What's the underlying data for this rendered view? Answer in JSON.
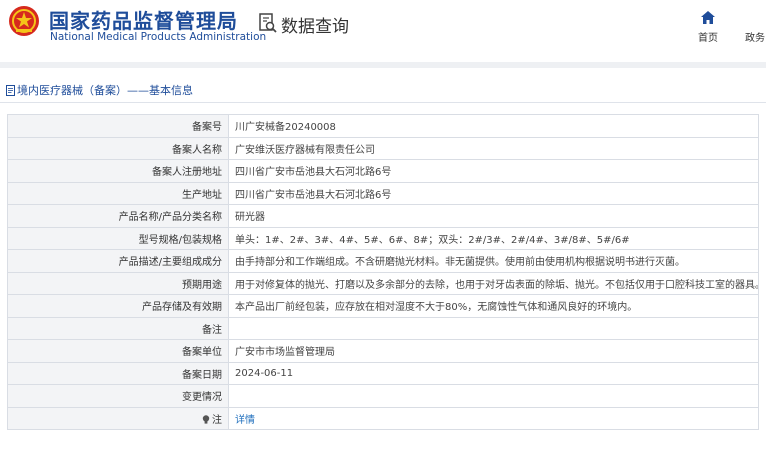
{
  "header": {
    "brand_cn": "国家药品监督管理局",
    "brand_en": "National Medical Products Administration",
    "search_label": "数据查询",
    "nav_home": "首页",
    "nav_gov": "政务"
  },
  "breadcrumb": "境内医疗器械（备案）——基本信息",
  "rows": [
    {
      "label": "备案号",
      "value": "川广安械备20240008"
    },
    {
      "label": "备案人名称",
      "value": "广安维沃医疗器械有限责任公司"
    },
    {
      "label": "备案人注册地址",
      "value": "四川省广安市岳池县大石河北路6号"
    },
    {
      "label": "生产地址",
      "value": "四川省广安市岳池县大石河北路6号"
    },
    {
      "label": "产品名称/产品分类名称",
      "value": "研光器"
    },
    {
      "label": "型号规格/包装规格",
      "value": "单头：1#、2#、3#、4#、5#、6#、8#；双头：2#/3#、2#/4#、3#/8#、5#/6#"
    },
    {
      "label": "产品描述/主要组成成分",
      "value": "由手持部分和工作端组成。不含研磨抛光材料。非无菌提供。使用前由使用机构根据说明书进行灭菌。"
    },
    {
      "label": "预期用途",
      "value": "用于对修复体的抛光、打磨以及多余部分的去除，也用于对牙齿表面的除垢、抛光。不包括仅用于口腔科技工室的器具。"
    },
    {
      "label": "产品存储及有效期",
      "value": "本产品出厂前经包装，应存放在相对湿度不大于80%，无腐蚀性气体和通风良好的环境内。"
    },
    {
      "label": "备注",
      "value": ""
    },
    {
      "label": "备案单位",
      "value": "广安市市场监督管理局"
    },
    {
      "label": "备案日期",
      "value": "2024-06-11"
    },
    {
      "label": "变更情况",
      "value": ""
    }
  ],
  "note_row": {
    "label": "注",
    "link": "详情"
  },
  "colors": {
    "brand": "#1f4d9a",
    "link": "#1f6fbd",
    "label_bg": "#f3f4f6",
    "border": "#d9dde4"
  }
}
